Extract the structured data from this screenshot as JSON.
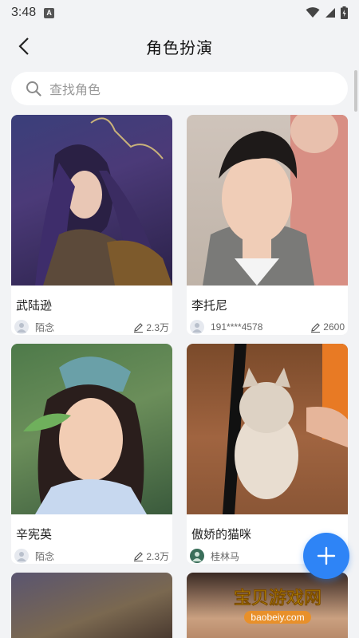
{
  "status_bar": {
    "time": "3:48",
    "notification_letter": "A"
  },
  "header": {
    "title": "角色扮演"
  },
  "search": {
    "placeholder": "查找角色"
  },
  "cards": [
    {
      "name": "武陆逊",
      "author": "陌念",
      "count": "2.3万",
      "image": "fantasy-warrior-portrait"
    },
    {
      "name": "李托尼",
      "author": "191****4578",
      "count": "2600",
      "image": "young-man-photo"
    },
    {
      "name": "辛宪英",
      "author": "陌念",
      "count": "2.3万",
      "image": "fantasy-maiden-portrait"
    },
    {
      "name": "傲娇的猫咪",
      "author": "桂林马",
      "count": "",
      "image": "standing-cat-photo"
    }
  ],
  "watermark": {
    "title": "宝贝游戏网",
    "url": "baobeiy.com"
  },
  "colors": {
    "accent": "#2e84f6",
    "background": "#f2f3f5"
  },
  "icons": [
    "back-arrow-icon",
    "search-icon",
    "user-icon",
    "pencil-icon",
    "plus-icon"
  ]
}
